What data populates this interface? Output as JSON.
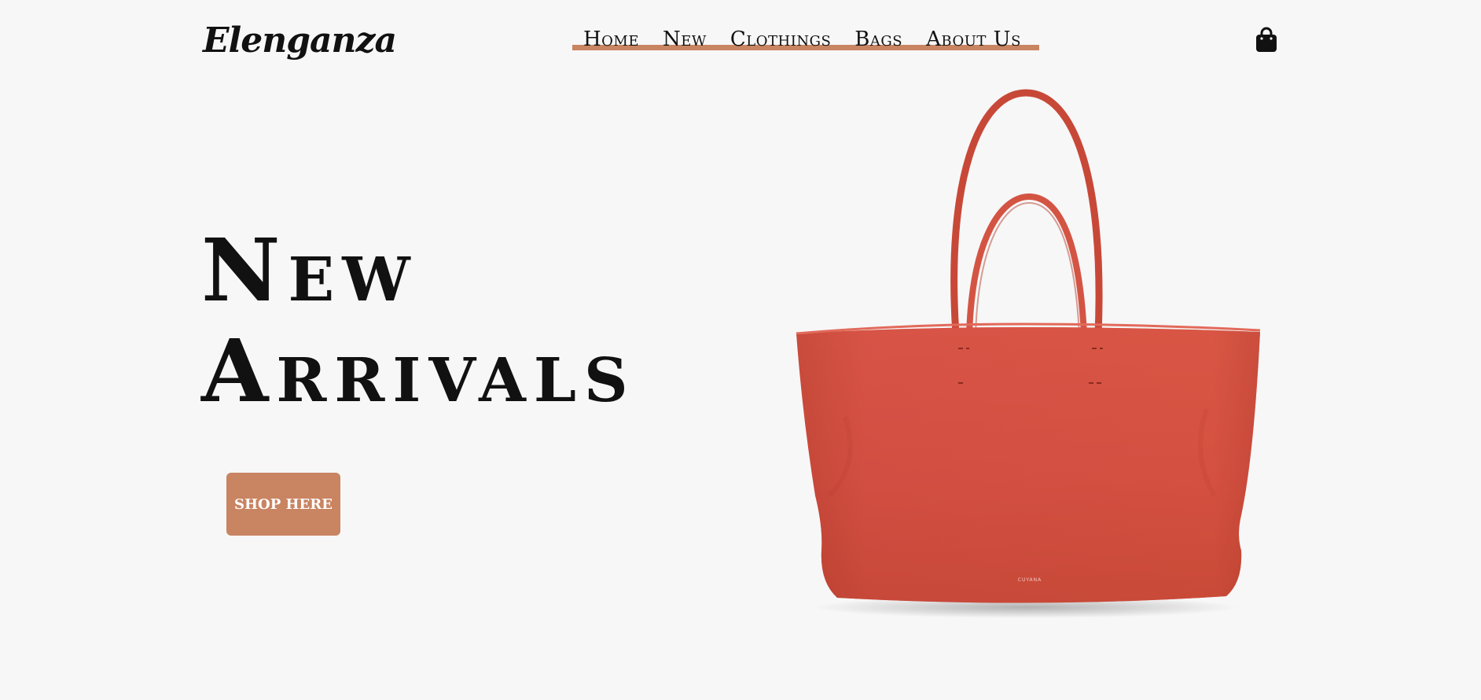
{
  "header": {
    "logo": "Elenganza",
    "nav": [
      "Home",
      "New",
      "Clothings",
      "Bags",
      "About Us"
    ],
    "cart_icon": "shopping-bag-icon"
  },
  "hero": {
    "title_line1": "New",
    "title_line2": "Arrivals",
    "cta": "SHOP HERE",
    "product_image": "red-tote-bag",
    "product_brand": "CUYANA"
  },
  "colors": {
    "background": "#f7f7f7",
    "accent": "#c98462",
    "bag": "#d24e42",
    "text": "#111111"
  }
}
